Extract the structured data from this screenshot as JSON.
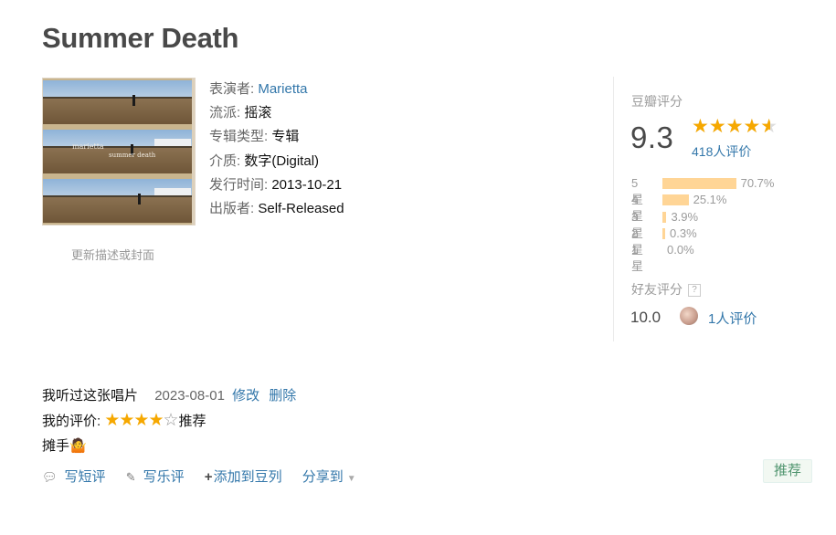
{
  "page": {
    "title": "Summer Death"
  },
  "cover": {
    "line1": "marietta",
    "line2": "summer death",
    "update_link": "更新描述或封面"
  },
  "info": [
    {
      "label": "表演者:",
      "value": "Marietta",
      "is_link": true
    },
    {
      "label": "流派:",
      "value": "摇滚",
      "is_link": false
    },
    {
      "label": "专辑类型:",
      "value": "专辑",
      "is_link": false
    },
    {
      "label": "介质:",
      "value": "数字(Digital)",
      "is_link": false
    },
    {
      "label": "发行时间:",
      "value": "2013-10-21",
      "is_link": false
    },
    {
      "label": "出版者:",
      "value": "Self-Released",
      "is_link": false
    }
  ],
  "rating": {
    "title": "豆瓣评分",
    "score": "9.3",
    "stars_fraction": 0.93,
    "people": "418人评价",
    "distribution": [
      {
        "label": "5星",
        "percent": "70.7%",
        "value": 70.7
      },
      {
        "label": "4星",
        "percent": "25.1%",
        "value": 25.1
      },
      {
        "label": "3星",
        "percent": "3.9%",
        "value": 3.9
      },
      {
        "label": "2星",
        "percent": "0.3%",
        "value": 0.3
      },
      {
        "label": "1星",
        "percent": "0.0%",
        "value": 0.0
      }
    ]
  },
  "friends": {
    "title": "好友评分",
    "help": "?",
    "score": "10.0",
    "count": "1人评价"
  },
  "mine": {
    "status": "我听过这张唱片",
    "date": "2023-08-01",
    "edit": "修改",
    "delete": "删除",
    "rating_label": "我的评价:",
    "rating_value": 4,
    "rating_word": "推荐",
    "comment": "摊手🤷"
  },
  "actions": {
    "short_review": "写短评",
    "music_review": "写乐评",
    "add_doulist": "添加到豆列",
    "share": "分享到"
  },
  "recommend_button": "推荐",
  "colors": {
    "link": "#3377aa",
    "star": "#f6a800",
    "bar": "#ffd596",
    "recommend": "#4f946e"
  }
}
